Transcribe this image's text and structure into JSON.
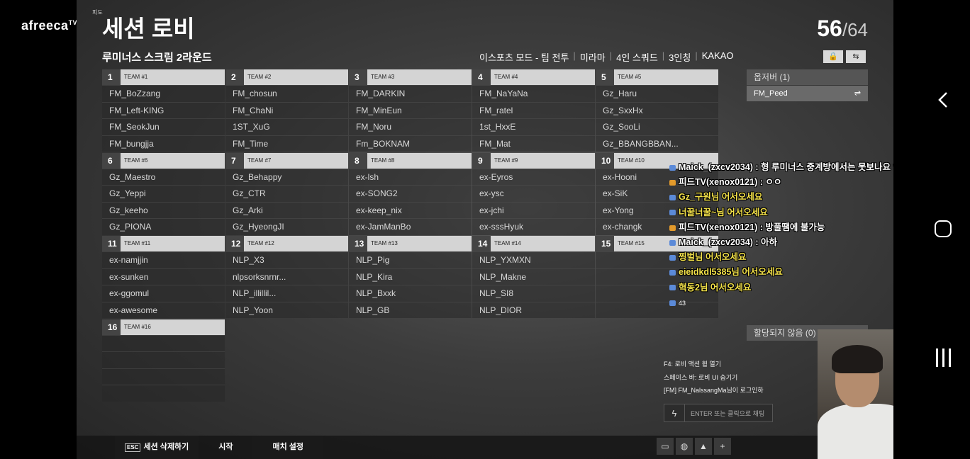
{
  "platform": {
    "logo": "afreeca",
    "logo_suffix": "TV"
  },
  "lobby": {
    "title": "세션 로비",
    "title_mini": "피도",
    "count_current": "56",
    "count_total": "/64",
    "subtitle": "루미너스 스크림 2라운드",
    "modes": [
      "이스포츠 모드 - 팀 전투",
      "미라마",
      "4인 스쿼드",
      "3인칭",
      "KAKAO"
    ],
    "lock_icon": "lock-icon",
    "swap_icon": "swap-icon"
  },
  "teams": [
    {
      "num": "1",
      "name": "TEAM #1",
      "players": [
        "FM_BoZzang",
        "FM_Left-KING",
        "FM_SeokJun",
        "FM_bungjja"
      ]
    },
    {
      "num": "2",
      "name": "TEAM #2",
      "players": [
        "FM_chosun",
        "FM_ChaNi",
        "1ST_XuG",
        "FM_Time"
      ]
    },
    {
      "num": "3",
      "name": "TEAM #3",
      "players": [
        "FM_DARKIN",
        "FM_MinEun",
        "FM_Noru",
        "Fm_BOKNAM"
      ]
    },
    {
      "num": "4",
      "name": "TEAM #4",
      "players": [
        "FM_NaYaNa",
        "FM_ratel",
        "1st_HxxE",
        "FM_Mat"
      ]
    },
    {
      "num": "5",
      "name": "TEAM #5",
      "players": [
        "Gz_Haru",
        "Gz_SxxHx",
        "Gz_SooLi",
        "Gz_BBANGBBAN..."
      ]
    },
    {
      "num": "6",
      "name": "TEAM #6",
      "players": [
        "Gz_Maestro",
        "Gz_Yeppi",
        "Gz_keeho",
        "Gz_PIONA"
      ]
    },
    {
      "num": "7",
      "name": "TEAM #7",
      "players": [
        "Gz_Behappy",
        "Gz_CTR",
        "Gz_Arki",
        "Gz_HyeongJI"
      ]
    },
    {
      "num": "8",
      "name": "TEAM #8",
      "players": [
        "ex-lsh",
        "ex-SONG2",
        "ex-keep_nix",
        "ex-JamManBo"
      ]
    },
    {
      "num": "9",
      "name": "TEAM #9",
      "players": [
        "ex-Eyros",
        "ex-ysc",
        "ex-jchi",
        "ex-sssHyuk"
      ]
    },
    {
      "num": "10",
      "name": "TEAM #10",
      "players": [
        "ex-Hooni",
        "ex-SiK",
        "ex-Yong",
        "ex-changk"
      ]
    },
    {
      "num": "11",
      "name": "TEAM #11",
      "players": [
        "ex-namjjin",
        "ex-sunken",
        "ex-ggomul",
        "ex-awesome"
      ]
    },
    {
      "num": "12",
      "name": "TEAM #12",
      "players": [
        "NLP_X3",
        "nlpsorksnrnr...",
        "NLP_illillil...",
        "NLP_Yoon"
      ]
    },
    {
      "num": "13",
      "name": "TEAM #13",
      "players": [
        "NLP_Pig",
        "NLP_Kira",
        "NLP_Bxxk",
        "NLP_GB"
      ]
    },
    {
      "num": "14",
      "name": "TEAM #14",
      "players": [
        "NLP_YXMXN",
        "NLP_Makne",
        "NLP_SI8",
        "NLP_DIOR"
      ]
    },
    {
      "num": "15",
      "name": "TEAM #15",
      "players": [
        "",
        "",
        "",
        ""
      ]
    },
    {
      "num": "16",
      "name": "TEAM #16",
      "players": [
        "",
        "",
        "",
        ""
      ]
    }
  ],
  "observer": {
    "header": "옵저버 (1)",
    "player": "FM_Peed",
    "swap_glyph": "⇌"
  },
  "unassigned": {
    "header": "할당되지 않음 (0)"
  },
  "chat": {
    "lines": [
      {
        "text": "Maick_(zxcv2034) : 형 루미너스 중계방에서는 못보나요 ?",
        "color": "white",
        "icon": "user-icon"
      },
      {
        "text": "피드TV(xenox0121) : ㅇㅇ",
        "color": "white",
        "icon": "bj-badge-icon"
      },
      {
        "text": "Gz_구원님 어서오세요",
        "color": "yellow",
        "icon": "fan-icon"
      },
      {
        "text": "너꿀너꿀~님 어서오세요",
        "color": "yellow",
        "icon": "fan-icon"
      },
      {
        "text": "피드TV(xenox0121) : 방풀땜에 불가능",
        "color": "white",
        "icon": "bj-badge-icon"
      },
      {
        "text": "Maick_(zxcv2034) : 아하",
        "color": "white",
        "icon": "user-icon"
      },
      {
        "text": "찡벌님 어서오세요",
        "color": "yellow",
        "icon": "fan-icon"
      },
      {
        "text": "eieidkdl5385님 어서오세요",
        "color": "yellow",
        "icon": "fan-icon"
      },
      {
        "text": "혁동2님 어서오세요",
        "color": "yellow",
        "icon": "fan-icon"
      }
    ],
    "viewers": "43"
  },
  "syslog": [
    "F4: 로비 액션 휠 열기",
    "스페이스 바: 로비 UI 숨기기",
    "[FM] FM_NalssangMa님이 로그인하"
  ],
  "chat_input": {
    "placeholder": "ENTER 또는 클릭으로 채팅"
  },
  "bottom_bar": {
    "esc_key": "ESC",
    "delete_session": "세션 삭제하기",
    "start": "시작",
    "match_settings": "매치 설정"
  },
  "bottom_icons": [
    "chat-icon",
    "globe-icon",
    "person-icon",
    "plus-icon",
    "plus-icon"
  ]
}
